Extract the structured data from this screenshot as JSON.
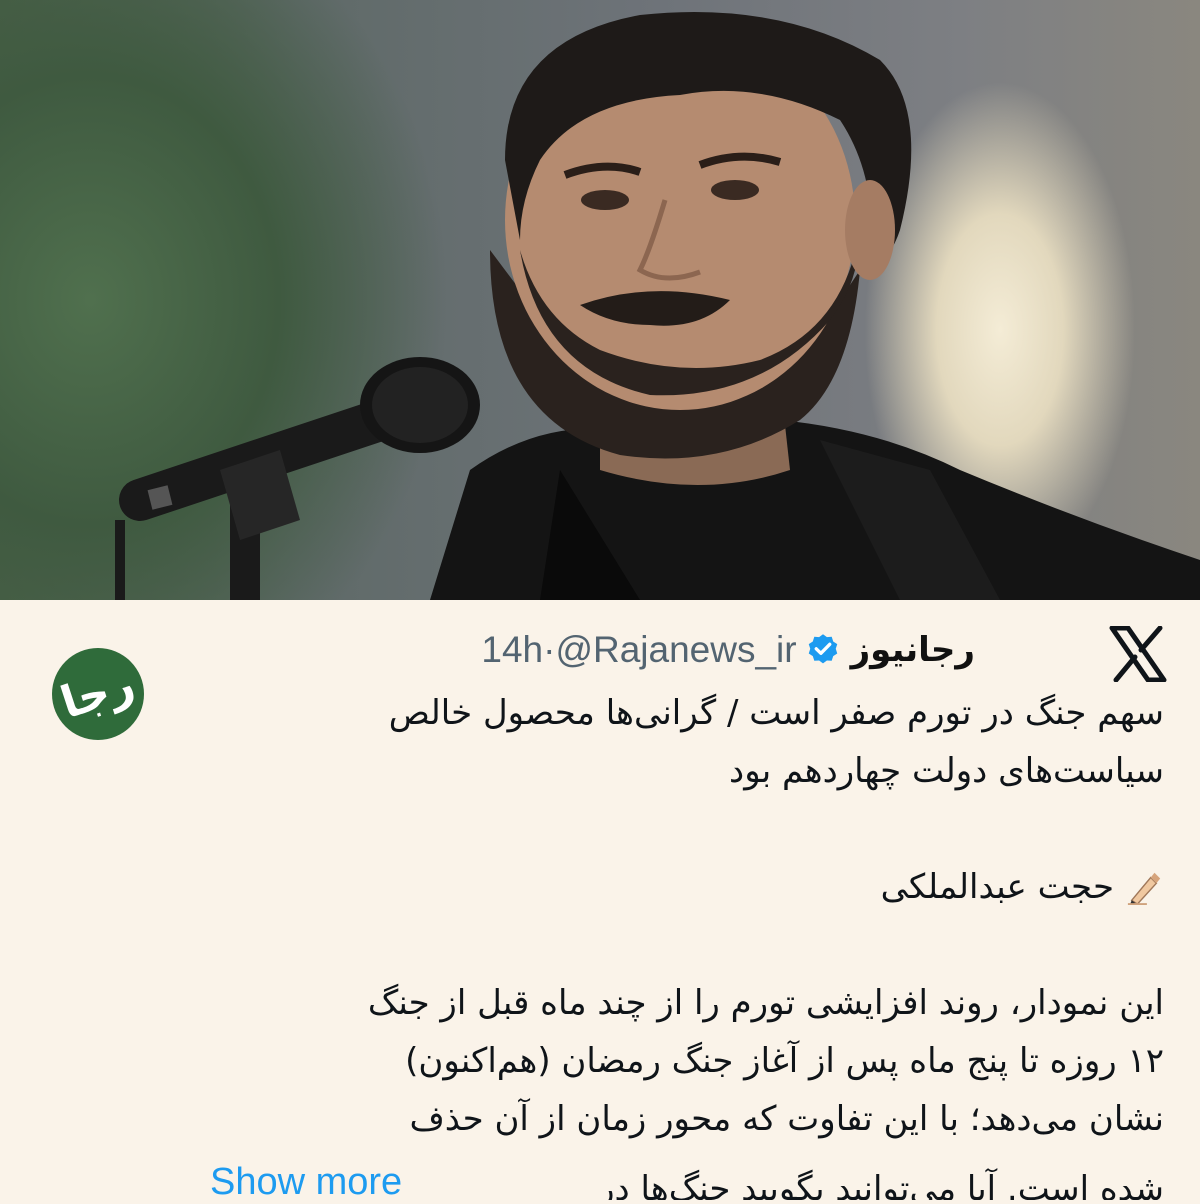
{
  "photo": {
    "alt": "Photo of a speaker at a microphone"
  },
  "post": {
    "display_name": "رجانیوز",
    "handle": "@Rajanews_ir",
    "separator": "·",
    "time": "14h",
    "avatar_mark": "رجا",
    "platform_icon": "x-logo-icon",
    "verified_icon": "verified-badge-icon",
    "lines": [
      "سهم جنگ در تورم صفر است / گرانی‌ها محصول خالص",
      "سیاست‌های دولت چهاردهم بود"
    ],
    "author": "حجت عبدالملکی",
    "author_icon": "writing-hand-icon",
    "body_lines": [
      "این نمودار، روند افزایشی تورم را از چند ماه قبل از جنگ",
      "۱۲ روزه تا پنج ماه پس از آغاز جنگ رمضان (هم‌اکنون)",
      "نشان می‌دهد؛ با این تفاوت که محور زمان از آن حذف",
      "شده است. آیا می‌توانید بگویید جنگ‌ها در"
    ],
    "show_more": "Show more"
  },
  "colors": {
    "link": "#1d9bf0",
    "verified": "#1d9bf0",
    "avatar_bg": "#2f6b3a",
    "card_bg": "#faf3e9"
  }
}
